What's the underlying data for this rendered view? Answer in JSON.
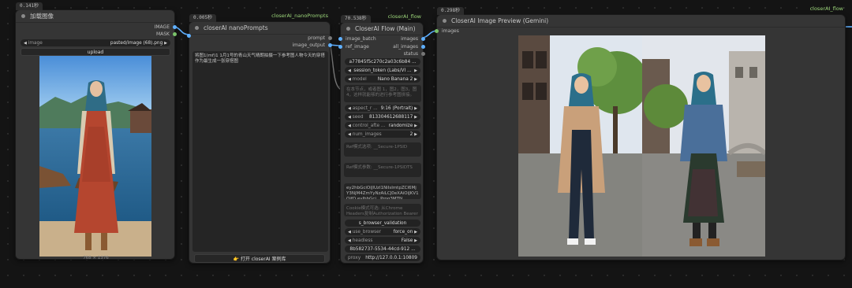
{
  "nodes": {
    "load": {
      "timing": "0.141秒",
      "title": "加载图像",
      "outputs": [
        "IMAGE",
        "MASK"
      ],
      "image_label": "image",
      "image_value": "pasted/image (68).png",
      "upload_label": "upload",
      "dims": "768 × 1376"
    },
    "prompts": {
      "timing": "0.005秒",
      "tag": "closerAI_nanoPrompts",
      "title": "closerAI nanoPrompts",
      "outputs": [
        "prompt",
        "image_output"
      ],
      "text": "将图1(mf)1 1月1号的青山天气晴朗拍摄一下参考图人物今天的穿搭作为最生成一张穿搭图",
      "footer_button": "👉 打开 closerAI 案例库"
    },
    "flow": {
      "timing": "70.538秒",
      "tag": "closerAI_flow",
      "title": "CloserAI Flow (Main)",
      "inputs": [
        "image_batch",
        "ref_image"
      ],
      "outputs": [
        "images",
        "all_images",
        "status"
      ],
      "hash": "a77845f5c270c2a03c6b84 ...",
      "session_label": "session_token (Labs/VI ...",
      "model_label": "model",
      "model_value": "Nano Banana 2",
      "info_text": "在本节点，或者图 1，图2，图3，图4，这样就能够的进行参考图拼接。",
      "aspect_label": "aspect_r ...",
      "aspect_value": "9:16 (Portrait)",
      "seed_label": "seed",
      "seed_value": "813304612688117",
      "control_label": "control_afte ...",
      "control_value": "randomize",
      "num_label": "num_images",
      "num_value": "2",
      "field1": "Ref模式选项: __Secure-1PSID",
      "field2": "Ref模式参数: __Secure-1PSIDTS",
      "token_text": "ey2hbGciOiJIUzI1NiIsImtpZCI6MjY3NjM4ZmYyNzAiLCJ0eXAiOiJKV1QifQ.eyJhbGci...Prog3MTN...",
      "cookie_text": "Cookie模式可选: 从Chrome Headers复制Authorization Bearer token",
      "browser_validation": "s_browser_validation",
      "use_browser_label": "use_browser",
      "use_browser_value": "force_on",
      "headless_label": "headless",
      "headless_value": "False",
      "uuid": "8b582737-5534-44cd-912 ...",
      "proxy_label": "proxy",
      "proxy_value": "http://127.0.0.1:10809"
    },
    "preview": {
      "timing": "0.298秒",
      "tag": "closerAI_flow",
      "title": "CloserAI Image Preview (Gemini)",
      "inputs": [
        "images"
      ]
    }
  },
  "colors": {
    "canvas": "#141414",
    "node": "#353535",
    "tag_green": "#9cd67a",
    "slot_blue": "#5fb0ff"
  }
}
